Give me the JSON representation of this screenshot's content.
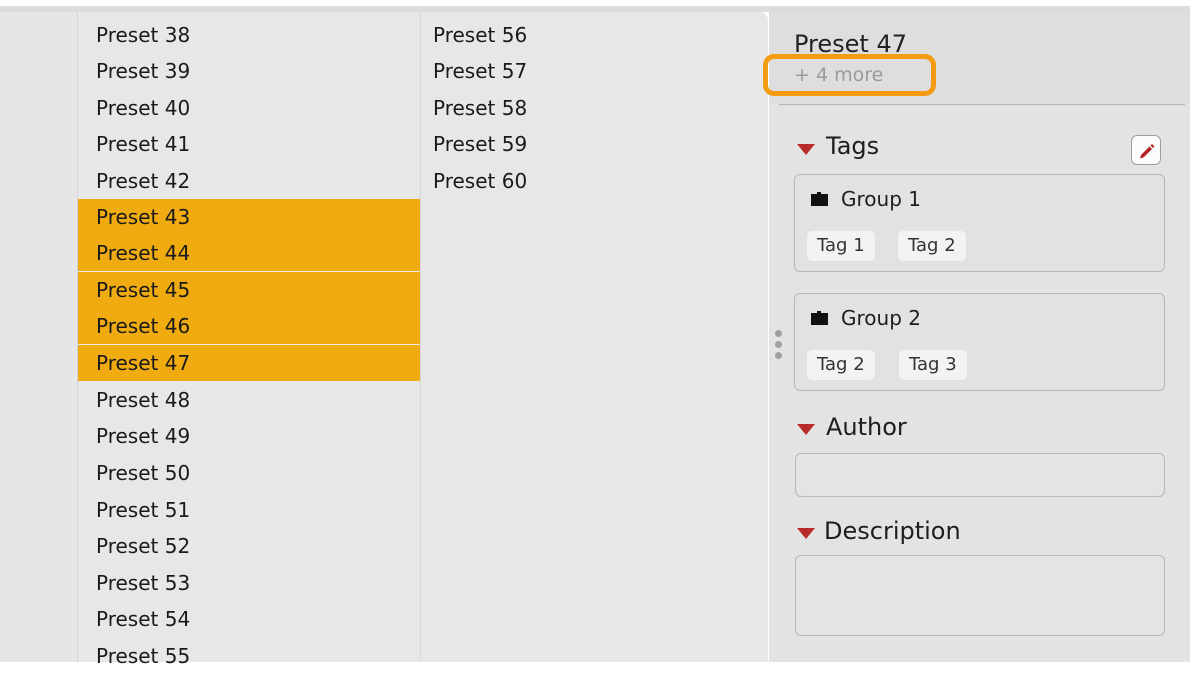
{
  "list": {
    "col1": [
      "Preset 38",
      "Preset 39",
      "Preset 40",
      "Preset 41",
      "Preset 42",
      "Preset 43",
      "Preset 44",
      "Preset 45",
      "Preset 46",
      "Preset 47",
      "Preset 48",
      "Preset 49",
      "Preset 50",
      "Preset 51",
      "Preset 52",
      "Preset 53",
      "Preset 54",
      "Preset 55"
    ],
    "col2": [
      "Preset 56",
      "Preset 57",
      "Preset 58",
      "Preset 59",
      "Preset 60"
    ],
    "selected": [
      "Preset 43",
      "Preset 44",
      "Preset 45",
      "Preset 46",
      "Preset 47"
    ]
  },
  "details": {
    "title": "Preset 47",
    "more": "+ 4 more",
    "tags_label": "Tags",
    "groups": [
      {
        "name": "Group 1",
        "tags": [
          "Tag 1",
          "Tag 2"
        ]
      },
      {
        "name": "Group 2",
        "tags": [
          "Tag 2",
          "Tag 3"
        ]
      }
    ],
    "author_label": "Author",
    "author_value": "",
    "description_label": "Description",
    "description_value": ""
  },
  "colors": {
    "selection": "#f0ab10",
    "highlight_outline": "#f39c12",
    "accent_red": "#b92b2b"
  }
}
